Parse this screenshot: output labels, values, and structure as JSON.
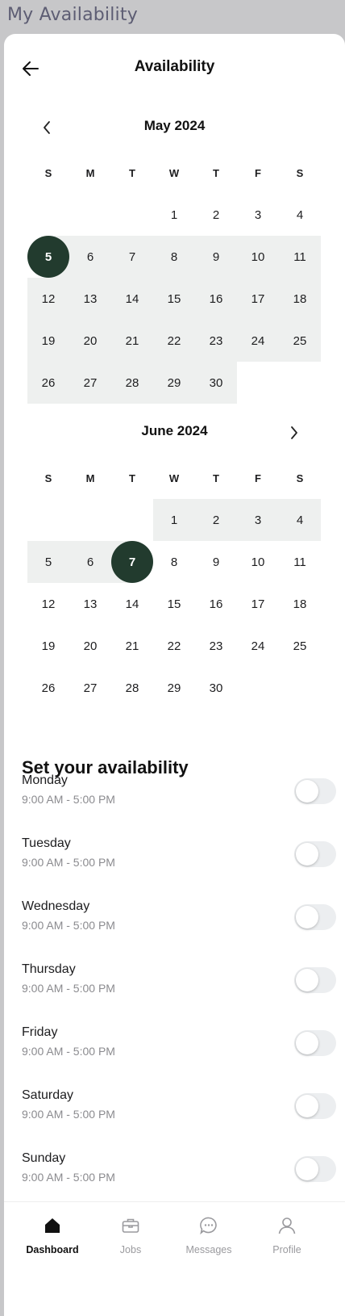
{
  "window": {
    "title": "My Availability"
  },
  "header": {
    "title": "Availability",
    "back_icon": "arrow-left-icon"
  },
  "weekdays": [
    "S",
    "M",
    "T",
    "W",
    "T",
    "F",
    "S"
  ],
  "may": {
    "title": "May 2024",
    "rows": [
      [
        "",
        "",
        "",
        "1",
        "2",
        "3",
        "4"
      ],
      [
        "5",
        "6",
        "7",
        "8",
        "9",
        "10",
        "11"
      ],
      [
        "12",
        "13",
        "14",
        "15",
        "16",
        "17",
        "18"
      ],
      [
        "19",
        "20",
        "21",
        "22",
        "23",
        "24",
        "25"
      ],
      [
        "26",
        "27",
        "28",
        "29",
        "30",
        "",
        ""
      ]
    ]
  },
  "june": {
    "title": "June 2024",
    "rows": [
      [
        "",
        "",
        "",
        "1",
        "2",
        "3",
        "4"
      ],
      [
        "5",
        "6",
        "7",
        "8",
        "9",
        "10",
        "11"
      ],
      [
        "12",
        "13",
        "14",
        "15",
        "16",
        "17",
        "18"
      ],
      [
        "19",
        "20",
        "21",
        "22",
        "23",
        "24",
        "25"
      ],
      [
        "26",
        "27",
        "28",
        "29",
        "30",
        "",
        ""
      ]
    ]
  },
  "selection": {
    "start": "5",
    "end": "7",
    "color": "#223b2e",
    "range_color": "#eef0ef"
  },
  "availability": {
    "title": "Set your availability",
    "days": [
      {
        "name": "Monday",
        "hours": "9:00 AM - 5:00 PM",
        "enabled": false
      },
      {
        "name": "Tuesday",
        "hours": "9:00 AM - 5:00 PM",
        "enabled": false
      },
      {
        "name": "Wednesday",
        "hours": "9:00 AM - 5:00 PM",
        "enabled": false
      },
      {
        "name": "Thursday",
        "hours": "9:00 AM - 5:00 PM",
        "enabled": false
      },
      {
        "name": "Friday",
        "hours": "9:00 AM - 5:00 PM",
        "enabled": false
      },
      {
        "name": "Saturday",
        "hours": "9:00 AM - 5:00 PM",
        "enabled": false
      },
      {
        "name": "Sunday",
        "hours": "9:00 AM - 5:00 PM",
        "enabled": false
      }
    ]
  },
  "tabs": [
    {
      "label": "Dashboard",
      "icon": "home-icon",
      "active": true
    },
    {
      "label": "Jobs",
      "icon": "briefcase-icon",
      "active": false
    },
    {
      "label": "Messages",
      "icon": "chat-bubble-icon",
      "active": false
    },
    {
      "label": "Profile",
      "icon": "user-icon",
      "active": false
    }
  ]
}
